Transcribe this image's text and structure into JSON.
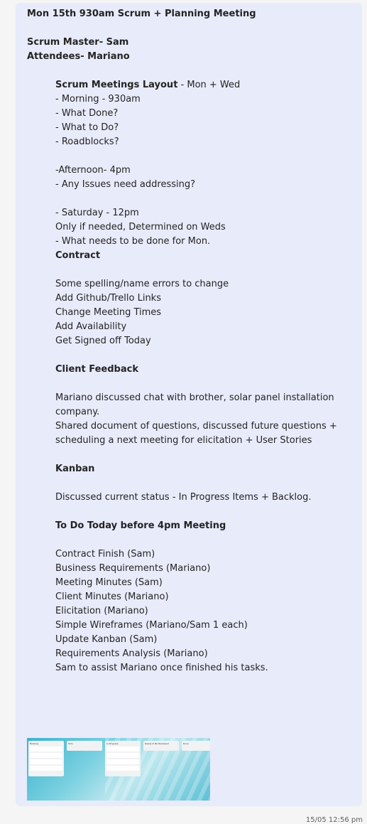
{
  "message": {
    "lines": [
      {
        "parts": [
          {
            "t": "Mon 15th 930am Scrum + Planning Meeting",
            "b": true
          }
        ],
        "ind": false
      },
      {
        "blank": true
      },
      {
        "parts": [
          {
            "t": "Scrum Master- Sam",
            "b": true
          }
        ],
        "ind": false
      },
      {
        "parts": [
          {
            "t": "Attendees- Mariano",
            "b": true
          }
        ],
        "ind": false
      },
      {
        "blank": true
      },
      {
        "parts": [
          {
            "t": "Scrum Meetings Layout",
            "b": true
          },
          {
            "t": " - Mon + Wed",
            "b": false
          }
        ],
        "ind": true
      },
      {
        "parts": [
          {
            "t": "- Morning - 930am",
            "b": false
          }
        ],
        "ind": true
      },
      {
        "parts": [
          {
            "t": "- What Done?",
            "b": false
          }
        ],
        "ind": true
      },
      {
        "parts": [
          {
            "t": "- What to Do?",
            "b": false
          }
        ],
        "ind": true
      },
      {
        "parts": [
          {
            "t": "- Roadblocks?",
            "b": false
          }
        ],
        "ind": true
      },
      {
        "blank": true
      },
      {
        "parts": [
          {
            "t": "-Afternoon- 4pm",
            "b": false
          }
        ],
        "ind": true
      },
      {
        "parts": [
          {
            "t": "- Any Issues need addressing?",
            "b": false
          }
        ],
        "ind": true
      },
      {
        "blank": true
      },
      {
        "parts": [
          {
            "t": "- Saturday - 12pm",
            "b": false
          }
        ],
        "ind": true
      },
      {
        "parts": [
          {
            "t": "Only if needed, Determined on Weds",
            "b": false
          }
        ],
        "ind": true
      },
      {
        "parts": [
          {
            "t": "- What needs to be done for Mon.",
            "b": false
          }
        ],
        "ind": true
      },
      {
        "parts": [
          {
            "t": "Contract",
            "b": true
          }
        ],
        "ind": true
      },
      {
        "blank": true
      },
      {
        "parts": [
          {
            "t": "Some spelling/name errors to change",
            "b": false
          }
        ],
        "ind": true
      },
      {
        "parts": [
          {
            "t": "Add Github/Trello Links",
            "b": false
          }
        ],
        "ind": true
      },
      {
        "parts": [
          {
            "t": "Change Meeting Times",
            "b": false
          }
        ],
        "ind": true
      },
      {
        "parts": [
          {
            "t": "Add Availability",
            "b": false
          }
        ],
        "ind": true
      },
      {
        "parts": [
          {
            "t": "Get Signed off Today",
            "b": false
          }
        ],
        "ind": true
      },
      {
        "blank": true
      },
      {
        "parts": [
          {
            "t": "Client Feedback",
            "b": true
          }
        ],
        "ind": true
      },
      {
        "blank": true
      },
      {
        "parts": [
          {
            "t": "Mariano discussed chat with brother, solar panel installation company.",
            "b": false
          }
        ],
        "ind": true,
        "wrap": true
      },
      {
        "parts": [
          {
            "t": "Shared document of questions, discussed future questions + scheduling a next meeting for elicitation + User Stories",
            "b": false
          }
        ],
        "ind": true,
        "wrap": true
      },
      {
        "blank": true
      },
      {
        "parts": [
          {
            "t": "Kanban",
            "b": true
          }
        ],
        "ind": true
      },
      {
        "blank": true
      },
      {
        "parts": [
          {
            "t": "Discussed current status - In Progress Items + Backlog.",
            "b": false
          }
        ],
        "ind": true
      },
      {
        "blank": true
      },
      {
        "parts": [
          {
            "t": "To Do Today before 4pm Meeting",
            "b": true
          }
        ],
        "ind": true
      },
      {
        "blank": true
      },
      {
        "parts": [
          {
            "t": "Contract Finish (Sam)",
            "b": false
          }
        ],
        "ind": true
      },
      {
        "parts": [
          {
            "t": "Business Requirements (Mariano)",
            "b": false
          }
        ],
        "ind": true
      },
      {
        "parts": [
          {
            "t": "Meeting Minutes (Sam)",
            "b": false
          }
        ],
        "ind": true
      },
      {
        "parts": [
          {
            "t": "Client Minutes (Mariano)",
            "b": false
          }
        ],
        "ind": true
      },
      {
        "parts": [
          {
            "t": "Elicitation (Mariano)",
            "b": false
          }
        ],
        "ind": true
      },
      {
        "parts": [
          {
            "t": "Simple Wireframes (Mariano/Sam 1 each)",
            "b": false
          }
        ],
        "ind": true
      },
      {
        "parts": [
          {
            "t": "Update Kanban (Sam)",
            "b": false
          }
        ],
        "ind": true
      },
      {
        "parts": [
          {
            "t": "Requirements Analysis (Mariano)",
            "b": false
          }
        ],
        "ind": true
      },
      {
        "parts": [
          {
            "t": "Sam to assist Mariano once finished his tasks.",
            "b": false
          }
        ],
        "ind": true
      }
    ]
  },
  "attachment": {
    "columns": [
      {
        "title": "Backlog",
        "cards": 4
      },
      {
        "title": "Todo",
        "cards": 0
      },
      {
        "title": "In Progress",
        "cards": 4
      },
      {
        "title": "Ready to Be Reviewed",
        "cards": 0
      },
      {
        "title": "Done",
        "cards": 0
      }
    ]
  },
  "timestamp": "15/05 12:56 pm",
  "top_glyph": "·"
}
